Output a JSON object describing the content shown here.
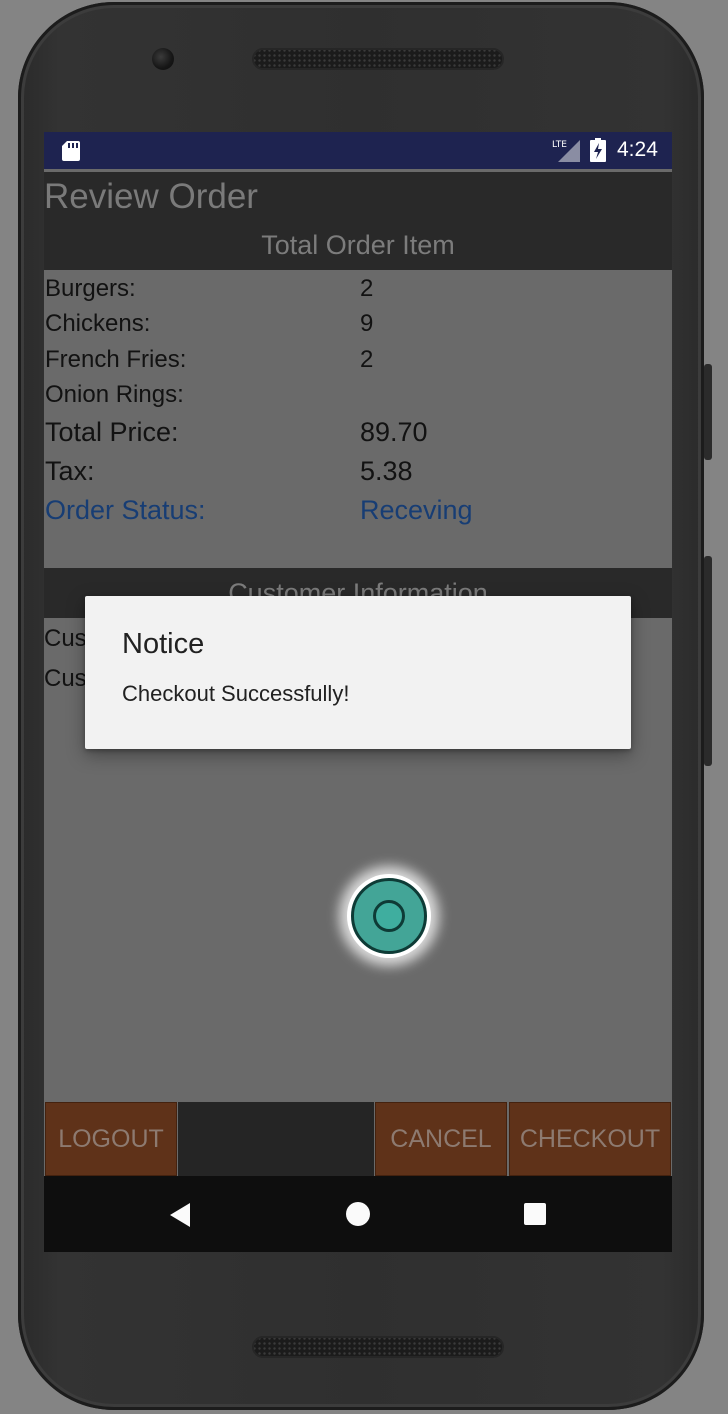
{
  "status_bar": {
    "time": "4:24",
    "network": "LTE",
    "icons": [
      "sd-card-icon",
      "lte-signal-icon",
      "battery-charging-icon"
    ]
  },
  "app": {
    "title": "Review Order"
  },
  "order_section": {
    "header": "Total Order Item",
    "items": [
      {
        "label": "Burgers:",
        "value": "2"
      },
      {
        "label": "Chickens:",
        "value": "9"
      },
      {
        "label": "French Fries:",
        "value": "2"
      },
      {
        "label": "Onion Rings:",
        "value": ""
      }
    ],
    "total_price": {
      "label": "Total Price:",
      "value": "89.70"
    },
    "tax": {
      "label": "Tax:",
      "value": "5.38"
    },
    "order_status": {
      "label": "Order Status:",
      "value": "Receving"
    }
  },
  "customer_section": {
    "header": "Customer Information",
    "line1_visible": "Cus",
    "line2_visible": "Cus"
  },
  "buttons": {
    "logout": "LOGOUT",
    "cancel": "CANCEL",
    "checkout": "CHECKOUT"
  },
  "dialog": {
    "title": "Notice",
    "message": "Checkout Successfully!"
  },
  "nav": {
    "icons": [
      "back-icon",
      "home-icon",
      "recents-icon"
    ]
  },
  "colors": {
    "status_bar": "#1e2350",
    "button_bg": "#5f3219",
    "order_status_text": "#173d74",
    "touch_indicator": "#43a597"
  }
}
